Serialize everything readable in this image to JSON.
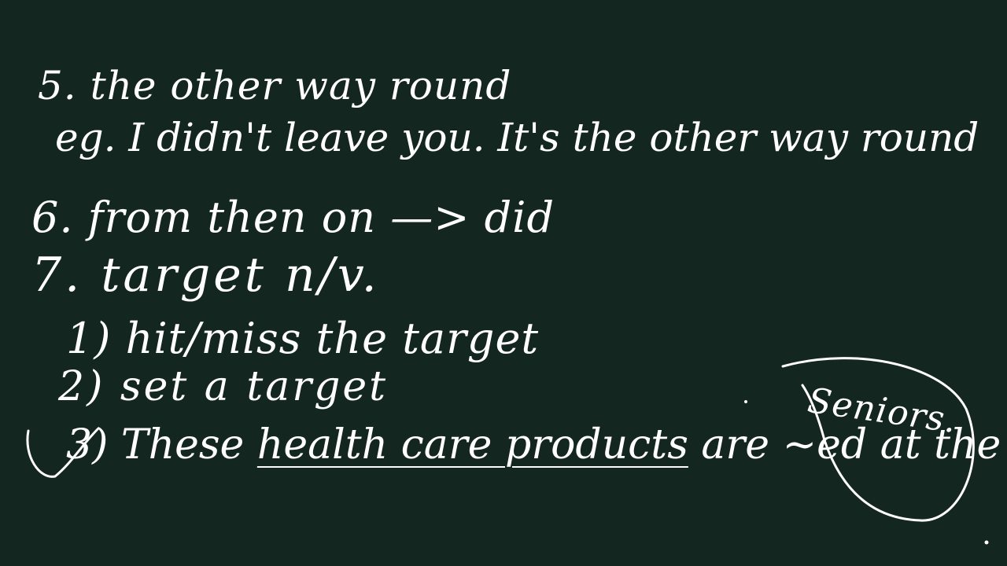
{
  "board": {
    "background": "#132620",
    "ink": "#ffffff",
    "lines": [
      {
        "text": "5. the other way round"
      },
      {
        "text": "eg. I didn't leave you. It's the other way round"
      },
      {
        "text": "6. from then on —> did"
      },
      {
        "text": "7. target n/v."
      },
      {
        "text": "1) hit/miss the target"
      },
      {
        "text": "2) set a target"
      },
      {
        "prefix": "3)",
        "before": "These ",
        "underlined": "health care products",
        "after": " are ~ed at the"
      }
    ],
    "side_note": "Seniors."
  }
}
